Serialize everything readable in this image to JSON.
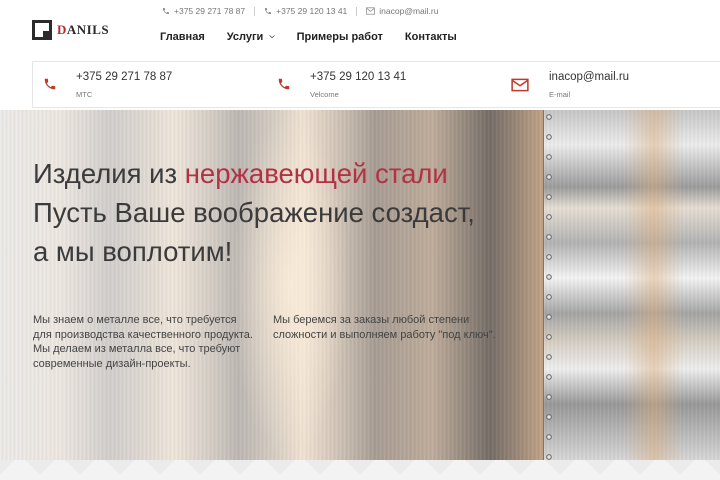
{
  "logo": {
    "text_accent": "D",
    "text_rest": "ANILS"
  },
  "topbar": {
    "phone1": "+375 29 271 78 87",
    "phone2": "+375 29 120 13 41",
    "email": "inacop@mail.ru"
  },
  "nav": {
    "items": [
      {
        "label": "Главная"
      },
      {
        "label": "Услуги",
        "has_dropdown": true,
        "dropdown_icon": "chevron-down-icon"
      },
      {
        "label": "Примеры работ"
      },
      {
        "label": "Контакты"
      }
    ]
  },
  "contacts": [
    {
      "value": "+375 29 271 78 87",
      "label": "МТС",
      "icon": "phone-icon"
    },
    {
      "value": "+375 29 120 13 41",
      "label": "Velcome",
      "icon": "phone-icon"
    },
    {
      "value": "inacop@mail.ru",
      "label": "E-mail",
      "icon": "mail-icon"
    }
  ],
  "hero": {
    "title_part1": "Изделия из ",
    "title_highlight": "нержавеющей стали",
    "title_line2": "Пусть Ваше воображение создаст,",
    "title_line3": "а мы воплотим!",
    "paragraph1": "Мы знаем о металле все, что требуется для производства качественного продукта. Мы делаем из металла все, что требуют современные дизайн-проекты.",
    "paragraph2": "Мы беремся за заказы любой степени сложности и выполняем работу \"под ключ\"."
  },
  "colors": {
    "accent": "#b23244",
    "icon_red": "#c0392b",
    "text_dark": "#3b3b3b"
  }
}
